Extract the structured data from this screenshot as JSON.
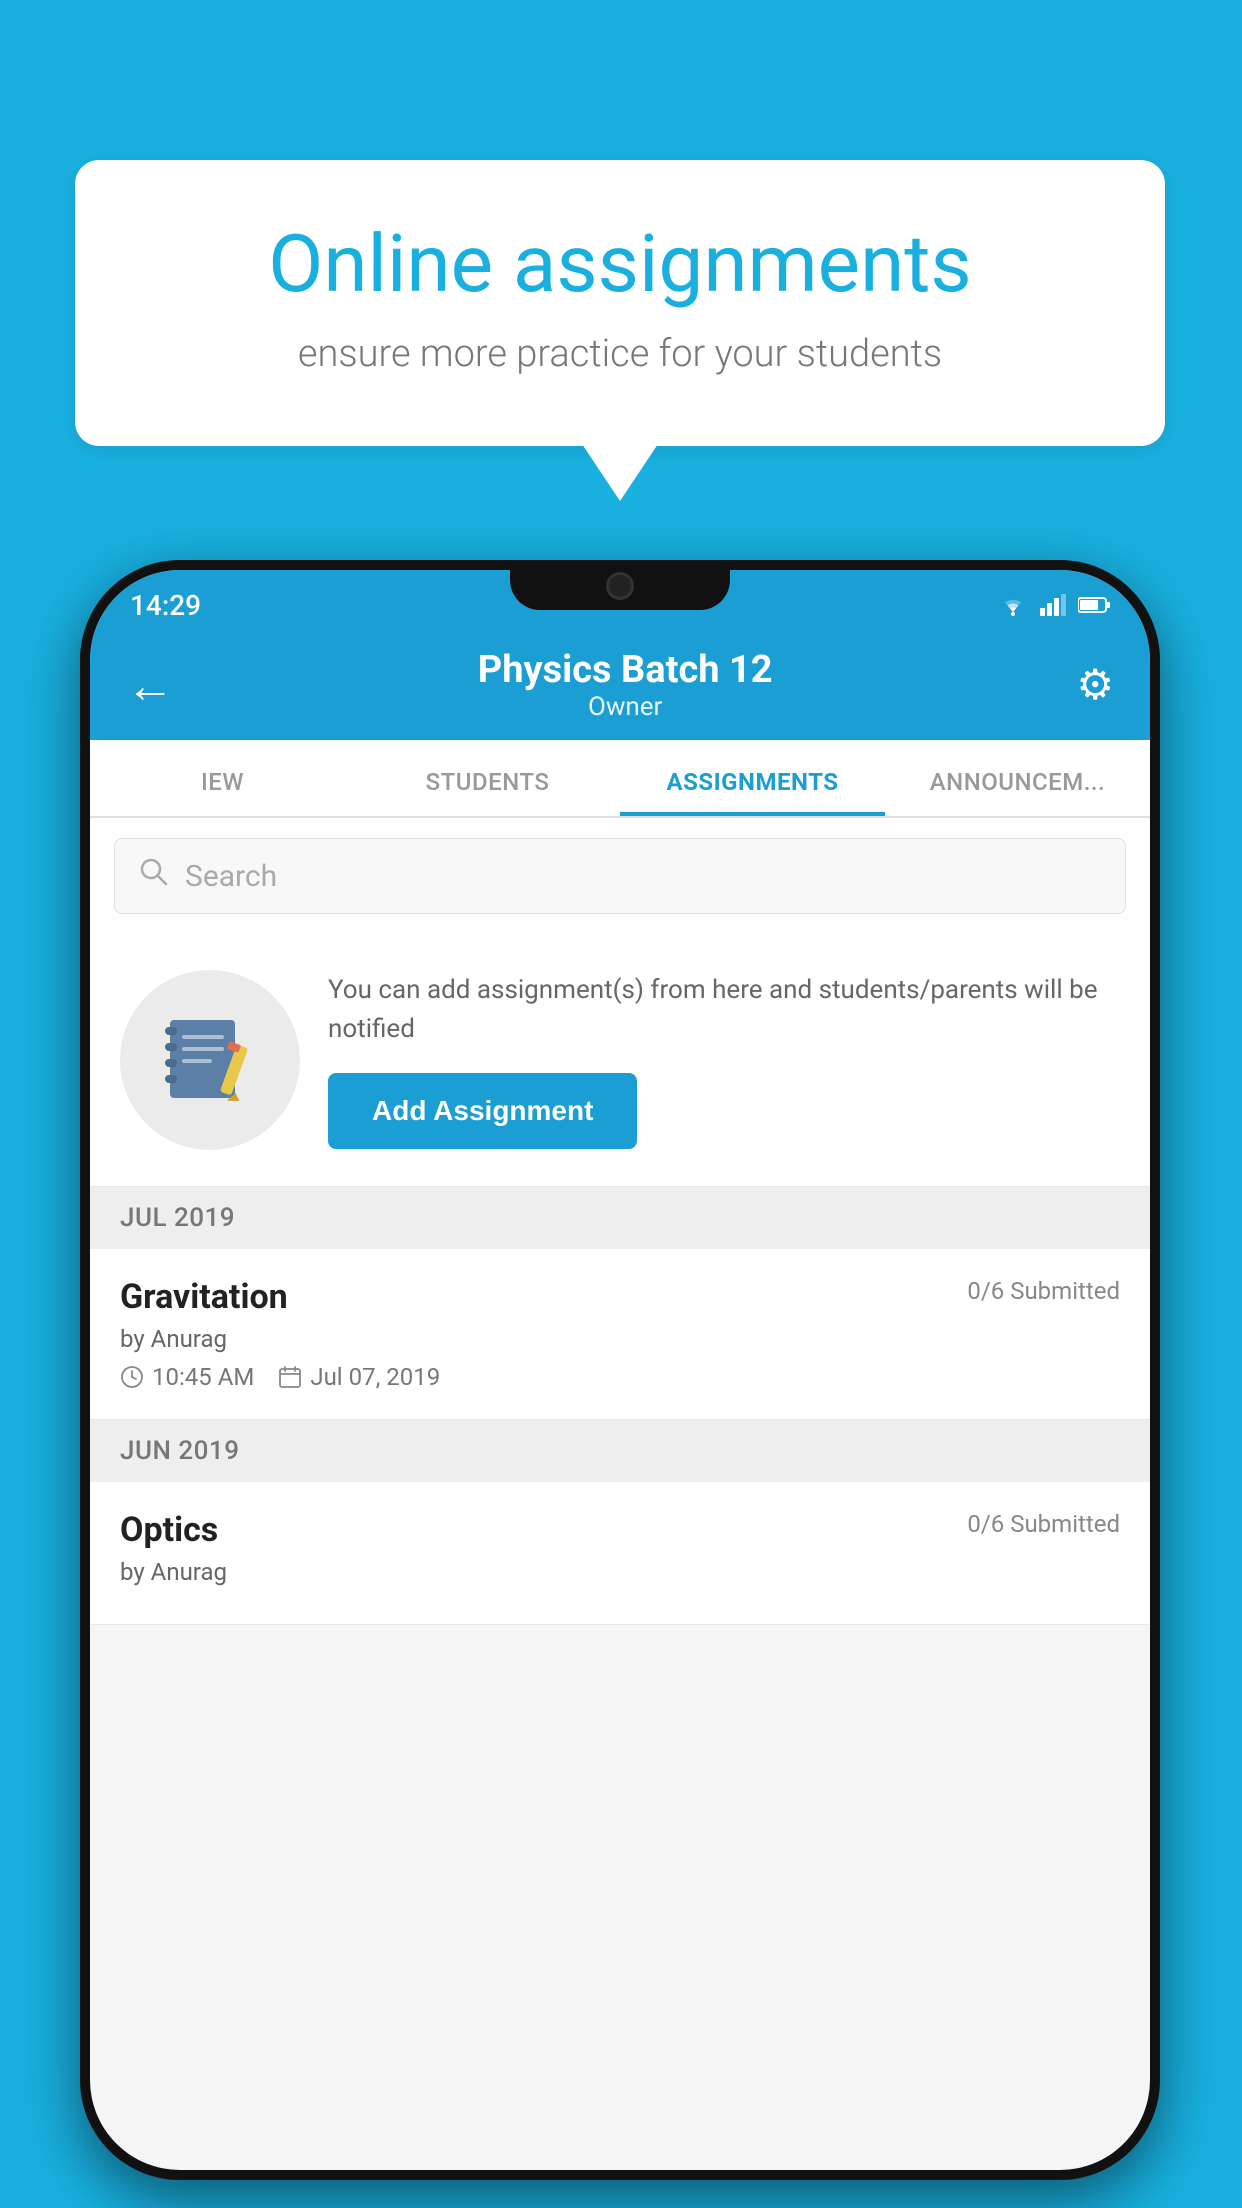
{
  "background": {
    "color": "#19b0e0"
  },
  "speech_bubble": {
    "title": "Online assignments",
    "subtitle": "ensure more practice for your students"
  },
  "phone": {
    "status_bar": {
      "time": "14:29",
      "signal_icons": [
        "wifi",
        "signal",
        "battery"
      ]
    },
    "app_bar": {
      "back_icon": "←",
      "title": "Physics Batch 12",
      "subtitle": "Owner",
      "settings_icon": "⚙"
    },
    "tabs": [
      {
        "label": "IEW",
        "active": false
      },
      {
        "label": "STUDENTS",
        "active": false
      },
      {
        "label": "ASSIGNMENTS",
        "active": true
      },
      {
        "label": "ANNOUNCEMENTS",
        "active": false
      }
    ],
    "search": {
      "placeholder": "Search"
    },
    "promo": {
      "description": "You can add assignment(s) from here and students/parents will be notified",
      "add_button_label": "Add Assignment"
    },
    "sections": [
      {
        "header": "JUL 2019",
        "assignments": [
          {
            "name": "Gravitation",
            "submitted": "0/6 Submitted",
            "by": "by Anurag",
            "time": "10:45 AM",
            "date": "Jul 07, 2019"
          }
        ]
      },
      {
        "header": "JUN 2019",
        "assignments": [
          {
            "name": "Optics",
            "submitted": "0/6 Submitted",
            "by": "by Anurag",
            "time": "",
            "date": ""
          }
        ]
      }
    ]
  }
}
